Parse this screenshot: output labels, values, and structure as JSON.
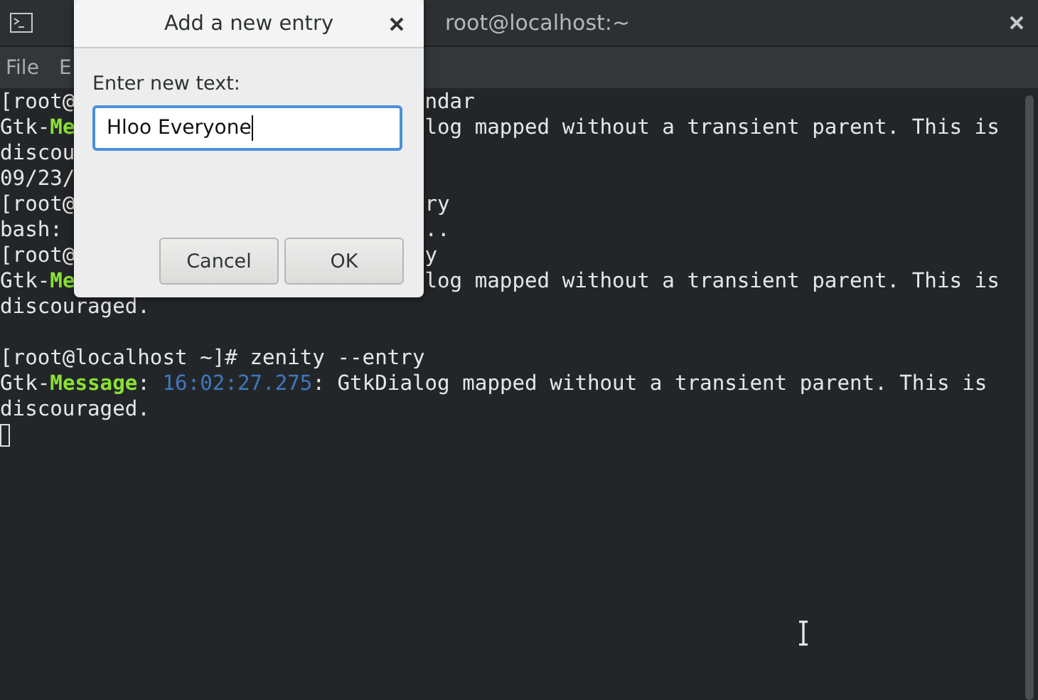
{
  "window": {
    "title": "root@localhost:~"
  },
  "menu": [
    "File",
    "E"
  ],
  "terminal": {
    "blocks": [
      {
        "lines": [
          {
            "left": [
              {
                "text": "[root@",
                "kind": "plain"
              }
            ],
            "right": [
              {
                "text": "ndar",
                "kind": "plain"
              }
            ]
          },
          {
            "left": [
              {
                "text": "Gtk-",
                "kind": "plain"
              },
              {
                "text": "Me",
                "kind": "keyword"
              }
            ],
            "right": [
              {
                "text": "log mapped without a transient parent. This is",
                "kind": "plain"
              }
            ]
          },
          {
            "left": [
              {
                "text": "discou",
                "kind": "plain"
              }
            ]
          },
          {
            "left": [
              {
                "text": "09/23/",
                "kind": "plain"
              }
            ]
          },
          {
            "left": [
              {
                "text": "[root@",
                "kind": "plain"
              }
            ],
            "right": [
              {
                "text": "ry",
                "kind": "plain"
              }
            ]
          },
          {
            "left": [
              {
                "text": "bash:",
                "kind": "plain"
              }
            ],
            "right": [
              {
                "text": "..",
                "kind": "plain"
              }
            ]
          },
          {
            "left": [
              {
                "text": "[root@",
                "kind": "plain"
              }
            ],
            "right": [
              {
                "text": "y",
                "kind": "plain"
              }
            ]
          },
          {
            "left": [
              {
                "text": "Gtk-",
                "kind": "plain"
              },
              {
                "text": "Me",
                "kind": "keyword"
              }
            ],
            "right": [
              {
                "text": "log mapped without a transient parent. This is",
                "kind": "plain"
              }
            ]
          },
          {
            "left": [
              {
                "text": "discouraged.",
                "kind": "plain"
              }
            ]
          }
        ]
      },
      {
        "lines": [
          {
            "left": [
              {
                "text": "[root@localhost ~]# zenity --entry",
                "kind": "plain"
              }
            ]
          },
          {
            "left": [
              {
                "text": "Gtk-",
                "kind": "plain"
              },
              {
                "text": "Message",
                "kind": "keyword"
              },
              {
                "text": ": ",
                "kind": "plain"
              },
              {
                "text": "16:02:27.275",
                "kind": "time"
              },
              {
                "text": ": GtkDialog mapped without a transient parent. This is",
                "kind": "plain"
              }
            ]
          },
          {
            "left": [
              {
                "text": "discouraged.",
                "kind": "plain"
              }
            ]
          }
        ]
      }
    ]
  },
  "dialog": {
    "title": "Add a new entry",
    "label": "Enter new text:",
    "value": "Hloo Everyone",
    "buttons": [
      "Cancel",
      "OK"
    ]
  }
}
